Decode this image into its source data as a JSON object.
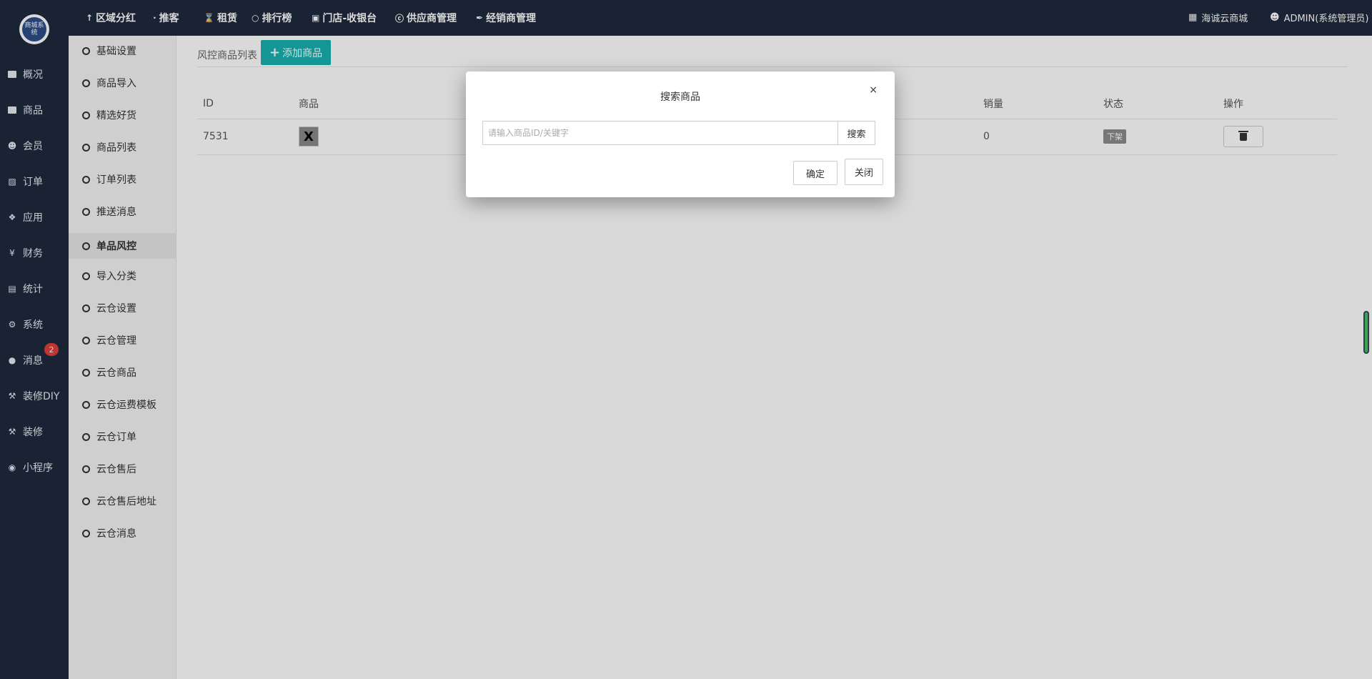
{
  "logo_text": "商城系统",
  "main_nav": [
    {
      "label": "概况",
      "icon": "dashboard-icon"
    },
    {
      "label": "商品",
      "icon": "box-icon"
    },
    {
      "label": "会员",
      "icon": "users-icon"
    },
    {
      "label": "订单",
      "icon": "cart-icon"
    },
    {
      "label": "应用",
      "icon": "cubes-icon"
    },
    {
      "label": "财务",
      "icon": "yen-icon"
    },
    {
      "label": "统计",
      "icon": "bar-chart-icon"
    },
    {
      "label": "系统",
      "icon": "gears-icon"
    },
    {
      "label": "消息",
      "icon": "comment-icon"
    },
    {
      "label": "装修DIY",
      "icon": "gavel-icon"
    },
    {
      "label": "装修",
      "icon": "gavel-icon"
    },
    {
      "label": "小程序",
      "icon": "wechat-icon"
    }
  ],
  "message_badge": "2",
  "top_nav": [
    {
      "label": "区域分红",
      "icon": "pin-icon"
    },
    {
      "label": "推客",
      "icon": "share-icon"
    },
    {
      "label": "租赁",
      "icon": "hourglass-icon"
    },
    {
      "label": "排行榜",
      "icon": "circle-icon"
    },
    {
      "label": "门店-收银台",
      "icon": "money-icon"
    },
    {
      "label": "供应商管理",
      "icon": "skype-icon"
    },
    {
      "label": "经销商管理",
      "icon": "signature-icon"
    }
  ],
  "top_right": {
    "shop": "海诚云商城",
    "user": "ADMIN(系统管理员)"
  },
  "sub_nav": [
    "基础设置",
    "商品导入",
    "精选好货",
    "商品列表",
    "订单列表",
    "推送消息",
    "单品风控",
    "导入分类",
    "云仓设置",
    "云仓管理",
    "云仓商品",
    "云仓运费模板",
    "云仓订单",
    "云仓售后",
    "云仓售后地址",
    "云仓消息"
  ],
  "sub_nav_active": "单品风控",
  "page": {
    "title": "风控商品列表",
    "add_button": "添加商品"
  },
  "table": {
    "headers": {
      "id": "ID",
      "goods": "商品",
      "sales": "销量",
      "status": "状态",
      "action": "操作"
    },
    "rows": [
      {
        "id": "7531",
        "thumb_glyph": "X",
        "sales": "0",
        "status": "下架"
      }
    ]
  },
  "modal": {
    "title": "搜索商品",
    "close_x": "×",
    "search_placeholder": "请输入商品ID/关键字",
    "search_button": "搜索",
    "ok_button": "确定",
    "close_button": "关闭"
  },
  "colors": {
    "sidebar_bg": "#1f2a3d",
    "accent_teal": "#18b1b1",
    "badge_red": "#e0403b"
  }
}
